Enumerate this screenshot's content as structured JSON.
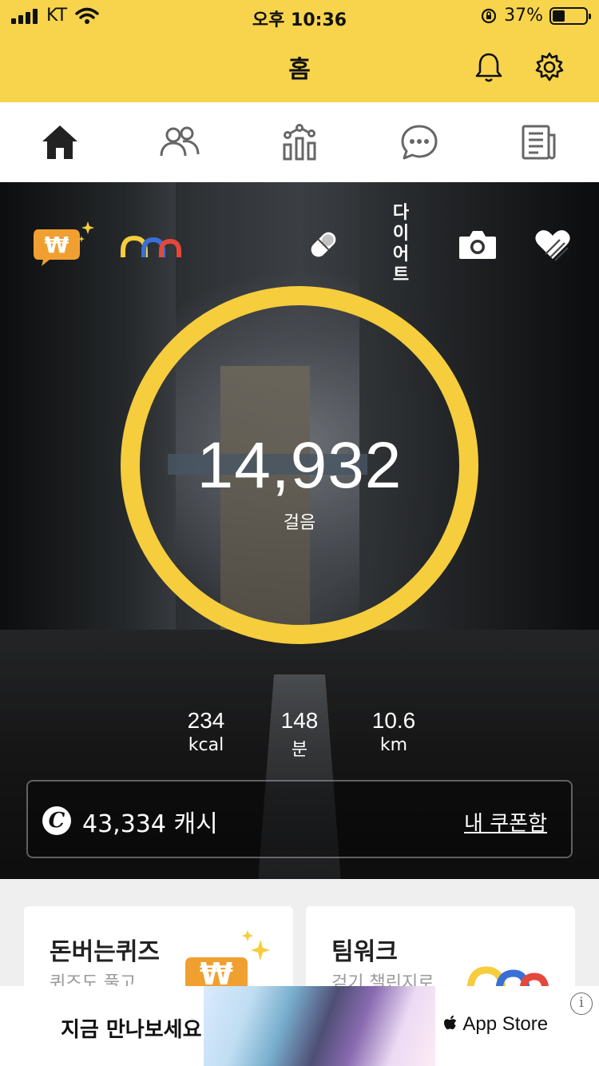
{
  "status_bar": {
    "carrier": "KT",
    "time": "오후 10:36",
    "battery": "37%",
    "battery_level": 0.37
  },
  "header": {
    "title": "홈",
    "icons": [
      "bell-icon",
      "gear-icon"
    ]
  },
  "tabs": [
    {
      "name": "home",
      "icon": "home-icon",
      "selected": true
    },
    {
      "name": "friends",
      "icon": "people-icon"
    },
    {
      "name": "stats",
      "icon": "chart-icon"
    },
    {
      "name": "chat",
      "icon": "chat-icon"
    },
    {
      "name": "news",
      "icon": "news-icon"
    }
  ],
  "quick_actions": {
    "quiz_icon": "won-coin-icon",
    "teamwork_icon": "arches-icon",
    "pill_icon": "pill-icon",
    "diet_label": "다이어트",
    "camera_icon": "camera-icon",
    "heart_icon": "heart-hand-icon"
  },
  "steps": {
    "count": "14,932",
    "label": "걸음"
  },
  "stats": [
    {
      "value": "234",
      "unit": "kcal"
    },
    {
      "value": "148",
      "unit": "분"
    },
    {
      "value": "10.6",
      "unit": "km"
    }
  ],
  "cash": {
    "coin_symbol": "C",
    "amount": "43,334 캐시",
    "link": "내 쿠폰함"
  },
  "cards": [
    {
      "title": "돈버는퀴즈",
      "subtitle": "퀴즈도 풀고"
    },
    {
      "title": "팀워크",
      "subtitle": "걷기 챌린지로"
    }
  ],
  "ad": {
    "text": "지금 만나보세요",
    "store": "App Store",
    "info": "i"
  },
  "colors": {
    "accent": "#f7d44c",
    "ring": "#f5cd3d",
    "orange": "#f0a030"
  }
}
